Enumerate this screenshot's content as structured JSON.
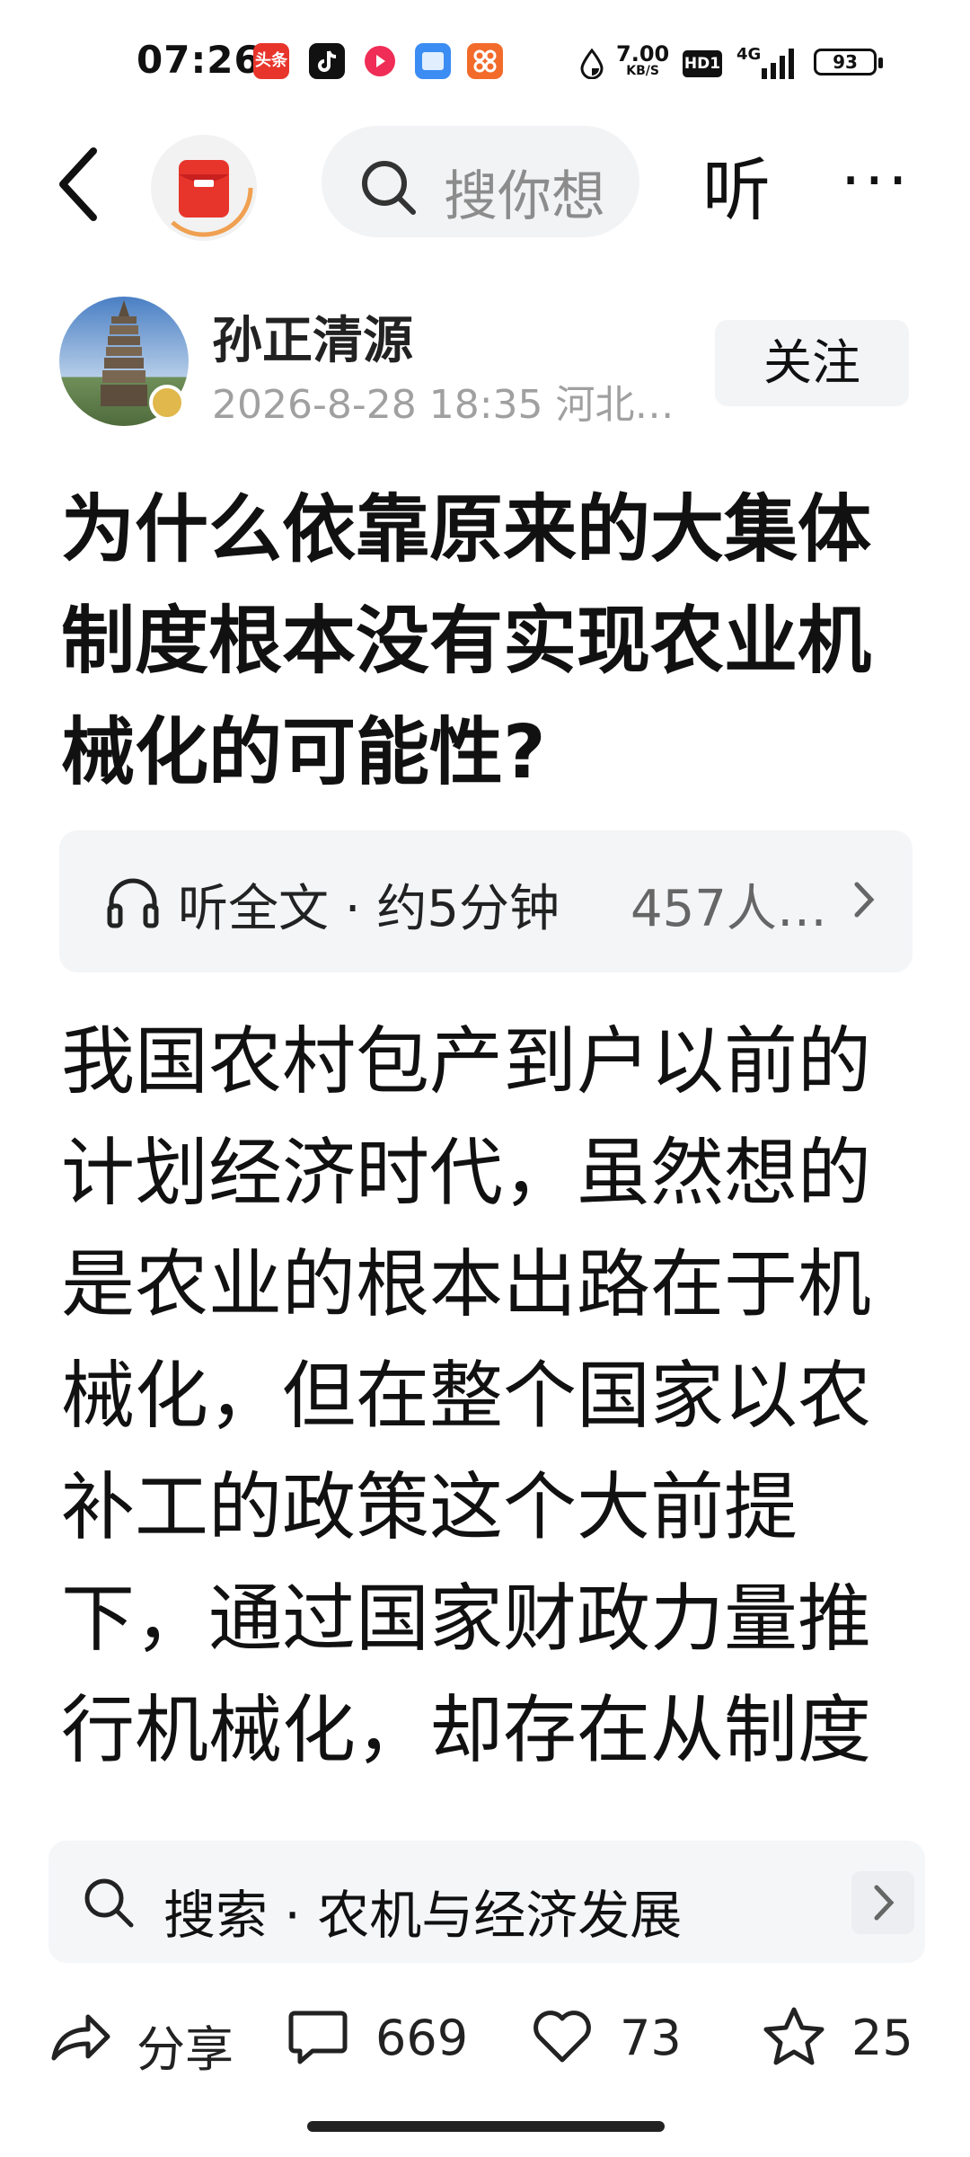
{
  "status_bar": {
    "time": "07:26",
    "toutiao_label": "头条",
    "net_speed_value": "7.00",
    "net_speed_unit": "KB/S",
    "hd_label": "HD1",
    "signal_label": "4G",
    "battery": "93"
  },
  "nav": {
    "search_placeholder": "搜你想",
    "listen_label": "听",
    "more_label": "···"
  },
  "author": {
    "name": "孙正清源",
    "meta": "2026-8-28  18:35  河北…",
    "follow_label": "关注"
  },
  "article": {
    "title": "为什么依靠原来的大集体制度根本没有实现农业机械化的可能性?",
    "listen_text": "听全文 · 约5分钟",
    "listen_count": "457人…",
    "body": "我国农村包产到户以前的计划经济时代，虽然想的是农业的根本出路在于机械化，但在整个国家以农补工的政策这个大前提下，通过国家财政力量推行机械化，却存在从制度"
  },
  "suggestion": {
    "text": "搜索 · 农机与经济发展"
  },
  "actions": {
    "share_label": "分享",
    "comment_count": "669",
    "like_count": "73",
    "favorite_count": "25"
  },
  "colors": {
    "accent_red": "#e8352c",
    "muted_text": "#a0a0a0",
    "card_bg": "#f4f5f7"
  }
}
